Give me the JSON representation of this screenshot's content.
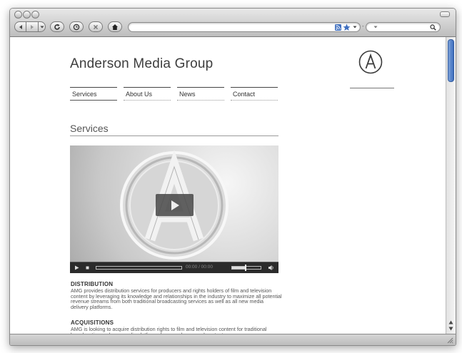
{
  "browser": {
    "window_buttons": [
      "close",
      "minimize",
      "zoom"
    ],
    "toolbar_icons": [
      "back-icon",
      "forward-icon",
      "dropdown-icon",
      "reload-icon",
      "history-icon",
      "stop-icon",
      "home-icon",
      "rss-icon",
      "bookmark-star-icon",
      "search-icon"
    ],
    "address_value": "",
    "search_value": "",
    "accent_color": "#3f6fbf"
  },
  "site": {
    "title": "Anderson Media Group",
    "logo_letter": "A"
  },
  "nav": {
    "items": [
      {
        "label": "Services",
        "active": true
      },
      {
        "label": "About Us",
        "active": false
      },
      {
        "label": "News",
        "active": false
      },
      {
        "label": "Contact",
        "active": false
      }
    ]
  },
  "page": {
    "section_title": "Services"
  },
  "video": {
    "watermark_letter": "A",
    "time_text": "00:00 / 00:00",
    "volume_fraction": 0.5,
    "progress_fraction": 0.0
  },
  "content": {
    "distribution_heading": "DISTRIBUTION",
    "distribution_text": "AMG provides distribution services for producers and rights holders of film and television content by leveraging its knowledge and relationships in the industry to maximize all potential revenue streams from both traditional broadcasting services as well as all new media delivery platforms.",
    "acquisitions_heading": "ACQUISITIONS",
    "acquisitions_text": "AMG is looking to acquire distribution rights to film and television content for traditional broadcasting and new media platforms from producers and content"
  }
}
